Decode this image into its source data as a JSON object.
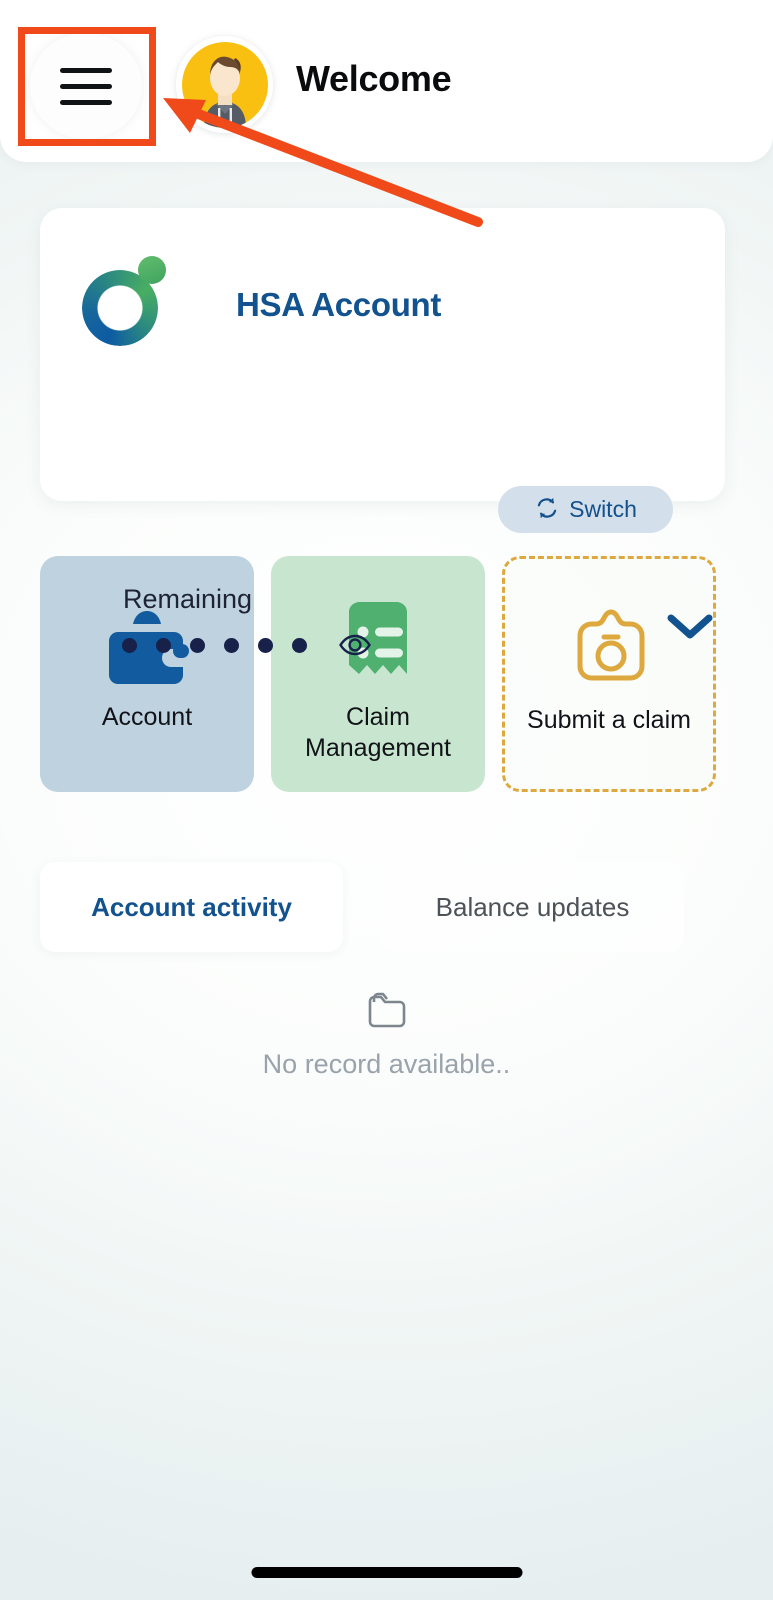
{
  "header": {
    "menu_icon": "hamburger-menu-icon",
    "avatar_icon": "user-avatar",
    "title": "Welcome"
  },
  "account_card": {
    "logo_icon": "brand-ring-logo",
    "account_name": "HSA Account",
    "switch": {
      "label": "Switch",
      "icon": "refresh-switch-icon",
      "bg_color": "#d3dfeb",
      "text_color": "#13508c"
    },
    "balance_label": "Remaining",
    "balance_masked": "● ● ● ● ● ●",
    "mask_dot_count": 6,
    "reveal_icon": "eye-icon",
    "expand_icon": "chevron-down-icon",
    "title_color": "#12528f"
  },
  "tiles": [
    {
      "label": "Account",
      "icon": "wallet-icon",
      "bg_color": "#bed2e0",
      "icon_color": "#115b9e",
      "style": "filled"
    },
    {
      "label": "Claim Management",
      "icon": "receipt-list-icon",
      "bg_color": "#c8e6cf",
      "icon_color": "#4fb070",
      "style": "filled"
    },
    {
      "label": "Submit a claim",
      "icon": "camera-icon",
      "bg_color": "transparent",
      "icon_color": "#dda93f",
      "style": "dashed"
    }
  ],
  "tabs": [
    {
      "label": "Account activity",
      "active": true
    },
    {
      "label": "Balance updates",
      "active": false
    }
  ],
  "empty_state": {
    "icon": "empty-folder-icon",
    "message": "No record available.."
  },
  "annotations": {
    "highlight_color": "#f04a1b",
    "target": "hamburger-menu-icon"
  },
  "system": {
    "home_indicator": "home-indicator-bar"
  }
}
